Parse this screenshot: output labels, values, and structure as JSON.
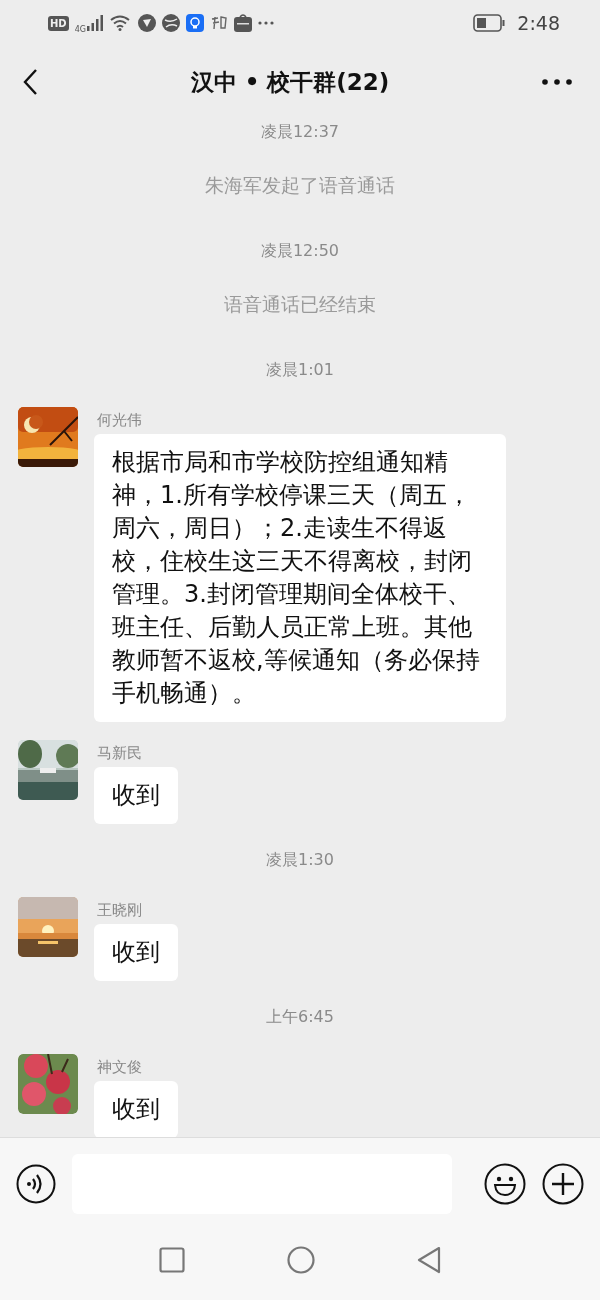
{
  "status_bar": {
    "hd": "HD",
    "network_type": "4G",
    "time": "2:48"
  },
  "header": {
    "title": "汉中 • 校干群(22)"
  },
  "messages": [
    {
      "kind": "time",
      "text": "凌晨12:37"
    },
    {
      "kind": "system",
      "text": "朱海军发起了语音通话"
    },
    {
      "kind": "time",
      "text": "凌晨12:50"
    },
    {
      "kind": "system",
      "text": "语音通话已经结束"
    },
    {
      "kind": "time",
      "text": "凌晨1:01"
    },
    {
      "kind": "message",
      "sender": "何光伟",
      "text": "根据市局和市学校防控组通知精神，1.所有学校停课三天（周五，周六，周日）；2.走读生不得返校，住校生这三天不得离校，封闭管理。3.封闭管理期间全体校干、班主任、后勤人员正常上班。其他教师暂不返校,等候通知（务必保持手机畅通）。"
    },
    {
      "kind": "message",
      "sender": "马新民",
      "text": "收到"
    },
    {
      "kind": "time",
      "text": "凌晨1:30"
    },
    {
      "kind": "message",
      "sender": "王晓刚",
      "text": "收到"
    },
    {
      "kind": "time",
      "text": "上午6:45"
    },
    {
      "kind": "message",
      "sender": "神文俊",
      "text": "收到"
    }
  ]
}
